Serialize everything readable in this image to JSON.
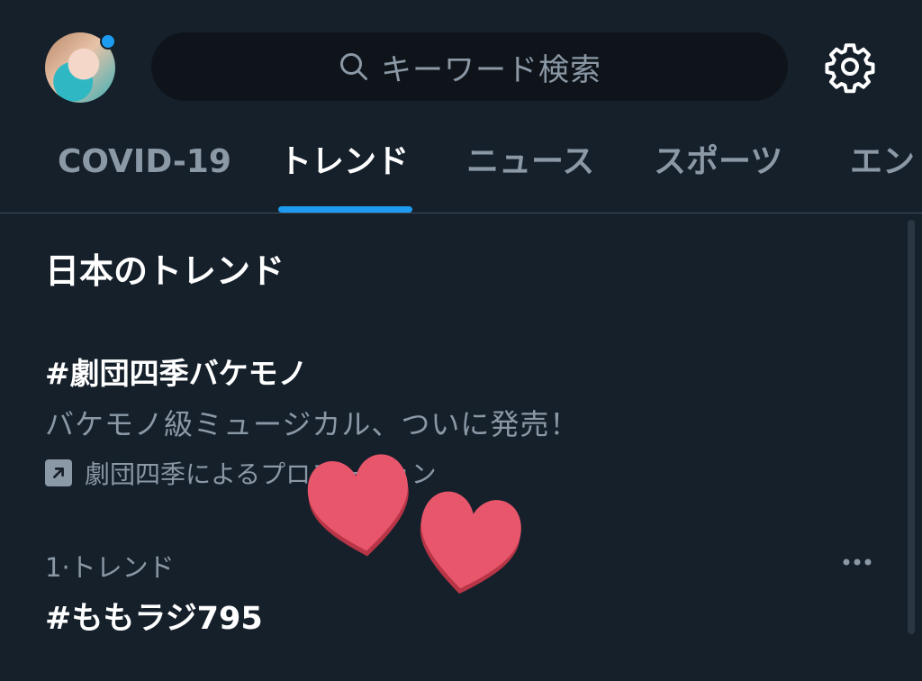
{
  "search": {
    "placeholder": "キーワード検索"
  },
  "tabs": [
    {
      "label": "COVID-19"
    },
    {
      "label": "トレンド"
    },
    {
      "label": "ニュース"
    },
    {
      "label": "スポーツ"
    },
    {
      "label": "エン"
    }
  ],
  "active_tab": "トレンド",
  "section": {
    "title": "日本のトレンド"
  },
  "promo": {
    "title": "#劇団四季バケモノ",
    "description": "バケモノ級ミュージカル、ついに発売！",
    "promoted_by": "劇団四季によるプロモーション"
  },
  "trends": [
    {
      "meta": "1·トレンド",
      "name": "#ももラジ795"
    }
  ],
  "icons": {
    "search": "search-icon",
    "settings": "gear-icon",
    "promoted": "promoted-arrow-icon",
    "more": "more-horizontal-icon"
  },
  "colors": {
    "background": "#15202b",
    "accent": "#1d9bf0",
    "secondary_text": "#8b98a5",
    "heart": "#e8566b"
  }
}
